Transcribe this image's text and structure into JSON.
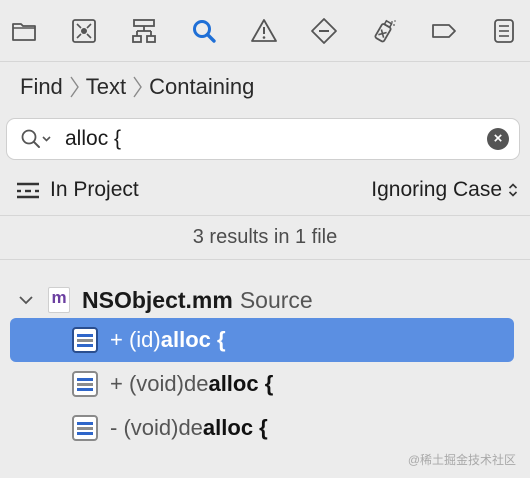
{
  "toolbar": {
    "icons": [
      "folder-icon",
      "source-control-icon",
      "hierarchy-icon",
      "search-icon",
      "warning-icon",
      "breakpoint-icon",
      "test-icon",
      "label-icon",
      "report-icon"
    ],
    "active_color": "#1f6fd6"
  },
  "breadcrumb": {
    "items": [
      "Find",
      "Text",
      "Containing"
    ]
  },
  "search": {
    "value": "alloc {"
  },
  "scope": {
    "left_label": "In Project",
    "right_label": "Ignoring Case"
  },
  "summary": "3 results in 1 file",
  "file": {
    "icon_letter": "m",
    "name": "NSObject.mm",
    "type": "Source"
  },
  "matches": [
    {
      "prefix": "+ (id)",
      "bold": "alloc {",
      "suffix": ""
    },
    {
      "prefix": "+ (void)de",
      "bold": "alloc {",
      "suffix": ""
    },
    {
      "prefix": "- (void)de",
      "bold": "alloc {",
      "suffix": ""
    }
  ],
  "watermark": "@稀土掘金技术社区",
  "colors": {
    "selection": "#5b8fe2",
    "background": "#ececec"
  }
}
